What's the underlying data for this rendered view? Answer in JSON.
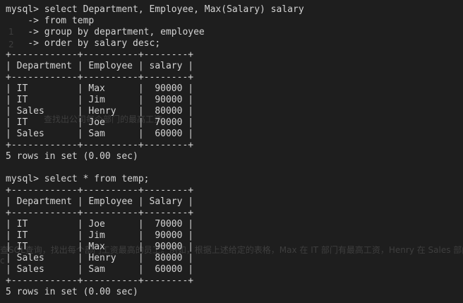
{
  "background_color": "#1e1e1e",
  "text_color": "#d4d4d4",
  "lines": [
    "mysql> select Department, Employee, Max(Salary) salary",
    "    -> from temp",
    "    -> group by department, employee",
    "    -> order by salary desc;",
    "+------------+----------+--------+",
    "| Department | Employee | salary |",
    "+------------+----------+--------+",
    "| IT         | Max      |  90000 |",
    "| IT         | Jim      |  90000 |",
    "| Sales      | Henry    |  80000 |",
    "| IT         | Joe      |  70000 |",
    "| Sales      | Sam      |  60000 |",
    "+------------+----------+--------+",
    "5 rows in set (0.00 sec)",
    "",
    "mysql> select * from temp;",
    "+------------+----------+--------+",
    "| Department | Employee | Salary |",
    "+------------+----------+--------+",
    "| IT         | Joe      |  70000 |",
    "| IT         | Jim      |  90000 |",
    "| IT         | Max      |  90000 |",
    "| Sales      | Henry    |  80000 |",
    "| Sales      | Sam      |  60000 |",
    "+------------+----------+--------+",
    "5 rows in set (0.00 sec)"
  ],
  "ghost_text": {
    "list_1": "1",
    "list_2": "2",
    "fragment_a": "查找出公司每个部门的最高工资",
    "fragment_b": "查SQL查询，找出每个部门工资最高的员工。例如，根据上述给定的表格，Max 在 IT 部门有最高工资，Henry 在 Sales 部门有最高工资。",
    "fragment_c": "c"
  }
}
